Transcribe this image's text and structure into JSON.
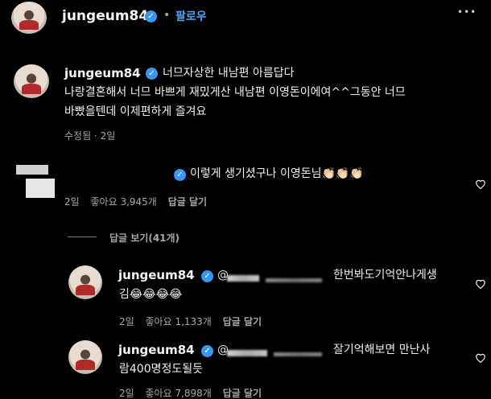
{
  "header": {
    "username": "jungeum84",
    "follow_label": "팔로우",
    "dot": "•",
    "more": "•••"
  },
  "caption": {
    "username": "jungeum84",
    "line1": "너므자상한 내남편 아름답다",
    "line2": "나랑결혼해서 너므 바쁘게 재밌게산 내남편 이영돈이에여^^그동안 너므",
    "line3": "바빴을텐데 이제편하게 즐겨요",
    "meta_edited": "수정됨 · 2일"
  },
  "comment1": {
    "text": "이렇게 생기셨구나 이영돈님👏🏻👏🏻👏🏻",
    "meta_time": "2일",
    "meta_likes": "좋아요 3,945개",
    "meta_reply": "답글 달기"
  },
  "view_replies": "답글 보기(41개)",
  "reply1": {
    "username": "jungeum84",
    "mention": "@",
    "line1": "한번봐도기억안나게생",
    "line2": "김😂😂😂😂",
    "meta_time": "2일",
    "meta_likes": "좋아요 1,133개",
    "meta_reply": "답글 달기"
  },
  "reply2": {
    "username": "jungeum84",
    "mention": "@",
    "line1": "잘기억해보면 만난사",
    "line2": "람400명정도될듯",
    "meta_time": "2일",
    "meta_likes": "좋아요 7,898개",
    "meta_reply": "답글 달기"
  },
  "icons": {
    "verified": "✓"
  }
}
